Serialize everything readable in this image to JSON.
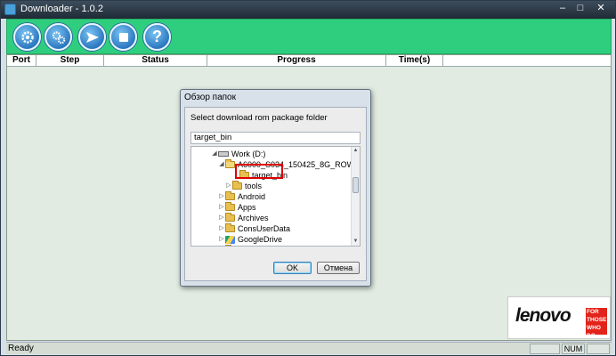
{
  "window": {
    "title": "Downloader - 1.0.2",
    "controls": {
      "minimize": "–",
      "maximize": "□",
      "close": "✕"
    }
  },
  "toolbar": {
    "buttons": [
      {
        "name": "settings-button",
        "icon": "gear-icon"
      },
      {
        "name": "advanced-settings-button",
        "icon": "gears-icon"
      },
      {
        "name": "start-button",
        "icon": "send-arrow-icon"
      },
      {
        "name": "stop-button",
        "icon": "stop-icon"
      },
      {
        "name": "help-button",
        "icon": "help-icon",
        "glyph": "?"
      }
    ],
    "accent_color": "#2fce7e"
  },
  "grid": {
    "columns": [
      "Port",
      "Step",
      "Status",
      "Progress",
      "Time(s)"
    ]
  },
  "status_bar": {
    "text": "Ready",
    "num": "NUM"
  },
  "logo": {
    "word": "lenovo",
    "tagline": [
      "FOR",
      "THOSE",
      "WHO DO."
    ]
  },
  "dialog": {
    "title": "Обзор папок",
    "prompt": "Select download rom package folder",
    "folder_value": "target_bin",
    "tree": [
      {
        "label": "Work (D:)",
        "expander": "◢",
        "icon": "drive-icon"
      },
      {
        "label": "A6000_S034_150425_8G_ROW",
        "expander": "◢",
        "icon": "folder-open-icon"
      },
      {
        "label": "target_bin",
        "expander": "",
        "icon": "folder-icon",
        "selected": true
      },
      {
        "label": "tools",
        "expander": "▷",
        "icon": "folder-icon"
      },
      {
        "label": "Android",
        "expander": "▷",
        "icon": "folder-icon"
      },
      {
        "label": "Apps",
        "expander": "▷",
        "icon": "folder-icon"
      },
      {
        "label": "Archives",
        "expander": "▷",
        "icon": "folder-icon"
      },
      {
        "label": "ConsUserData",
        "expander": "▷",
        "icon": "folder-icon"
      },
      {
        "label": "GoogleDrive",
        "expander": "▷",
        "icon": "google-drive-icon"
      },
      {
        "label": "IT",
        "expander": "▷",
        "icon": "folder-icon"
      }
    ],
    "ok_label": "OK",
    "cancel_label": "Отмена"
  }
}
